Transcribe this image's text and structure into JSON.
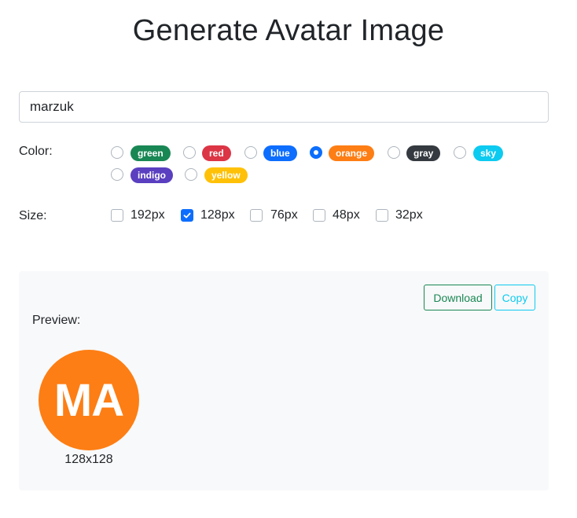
{
  "title": "Generate Avatar Image",
  "name_input": {
    "value": "marzuk",
    "placeholder": ""
  },
  "color": {
    "label": "Color:",
    "selected": "orange",
    "options": [
      {
        "label": "green",
        "bg": "#198754",
        "fg": "#ffffff",
        "checked": false
      },
      {
        "label": "red",
        "bg": "#dc3545",
        "fg": "#ffffff",
        "checked": false
      },
      {
        "label": "blue",
        "bg": "#0d6efd",
        "fg": "#ffffff",
        "checked": false
      },
      {
        "label": "orange",
        "bg": "#fd7e14",
        "fg": "#ffffff",
        "checked": true
      },
      {
        "label": "gray",
        "bg": "#343a40",
        "fg": "#ffffff",
        "checked": false
      },
      {
        "label": "sky",
        "bg": "#0dcaf0",
        "fg": "#ffffff",
        "checked": false
      },
      {
        "label": "indigo",
        "bg": "#5a3fc0",
        "fg": "#ffffff",
        "checked": false
      },
      {
        "label": "yellow",
        "bg": "#ffc107",
        "fg": "#ffffff",
        "checked": false
      }
    ]
  },
  "size": {
    "label": "Size:",
    "options": [
      {
        "label": "192px",
        "checked": false
      },
      {
        "label": "128px",
        "checked": true
      },
      {
        "label": "76px",
        "checked": false
      },
      {
        "label": "48px",
        "checked": false
      },
      {
        "label": "32px",
        "checked": false
      }
    ]
  },
  "preview": {
    "download_label": "Download",
    "copy_label": "Copy",
    "label": "Preview:",
    "avatar_initials": "MA",
    "avatar_color": "#fd7e14",
    "avatar_size_text": "128x128"
  }
}
